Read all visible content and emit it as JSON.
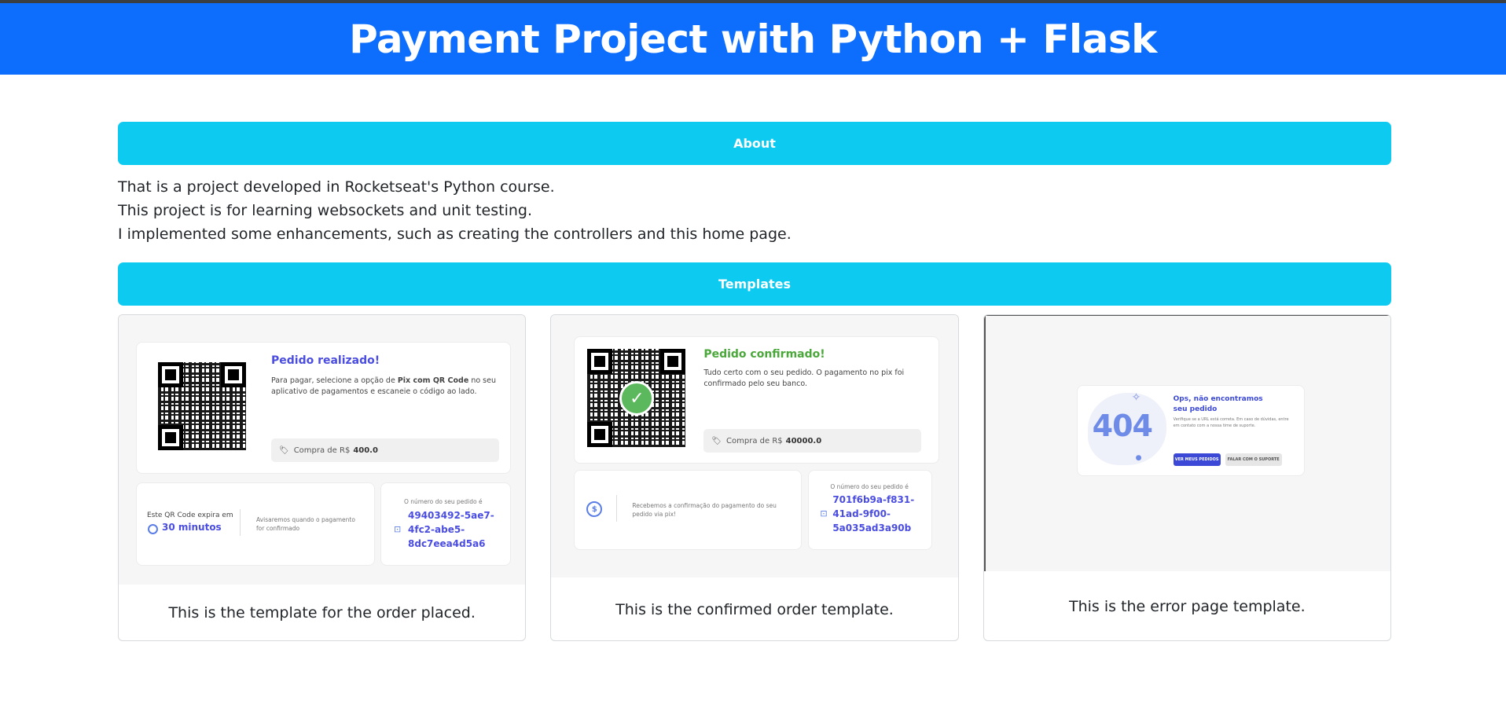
{
  "header": {
    "title": "Payment Project with Python + Flask"
  },
  "about": {
    "heading": "About",
    "lines": [
      "That is a project developed in Rocketseat's Python course.",
      "This project is for learning websockets and unit testing.",
      "I implemented some enhancements, such as creating the controllers and this home page."
    ]
  },
  "templates": {
    "heading": "Templates",
    "cards": [
      {
        "caption": "This is the template for the order placed.",
        "preview": {
          "title": "Pedido realizado!",
          "desc_pre": "Para pagar, selecione a opção de ",
          "desc_bold": "Pix com QR Code",
          "desc_post": " no seu aplicativo de pagamentos e escaneie o código ao lado.",
          "price_label": "Compra de R$",
          "price_value": "400.0",
          "expires_label": "Este QR Code expira em",
          "expires_value": "30 minutos",
          "notify_text": "Avisaremos quando o pagamento for confirmado",
          "order_label": "O número do seu pedido é",
          "order_id": "49403492-5ae7-4fc2-abe5-8dc7eea4d5a6"
        }
      },
      {
        "caption": "This is the confirmed order template.",
        "preview": {
          "title": "Pedido confirmado!",
          "desc": "Tudo certo com o seu pedido. O pagamento no pix foi confirmado pelo seu banco.",
          "price_label": "Compra de R$",
          "price_value": "40000.0",
          "received_text": "Recebemos a confirmação do pagamento do seu pedido via pix!",
          "order_label": "O número do seu pedido é",
          "order_id": "701f6b9a-f831-41ad-9f00-5a035ad3a90b"
        }
      },
      {
        "caption": "This is the error page template.",
        "preview": {
          "code": "404",
          "title": "Ops, não encontramos seu pedido",
          "desc": "Verifique se a URL está correta. Em caso de dúvidas, entre em contato com a nossa time de suporte.",
          "btn_primary": "VER MEUS PEDIDOS",
          "btn_secondary": "FALAR COM O SUPORTE"
        }
      }
    ]
  },
  "colors": {
    "header_bg": "#0d6efd",
    "section_bar": "#0dcaf0",
    "accent_purple": "#4a4de0",
    "success_green": "#5cb85c"
  }
}
